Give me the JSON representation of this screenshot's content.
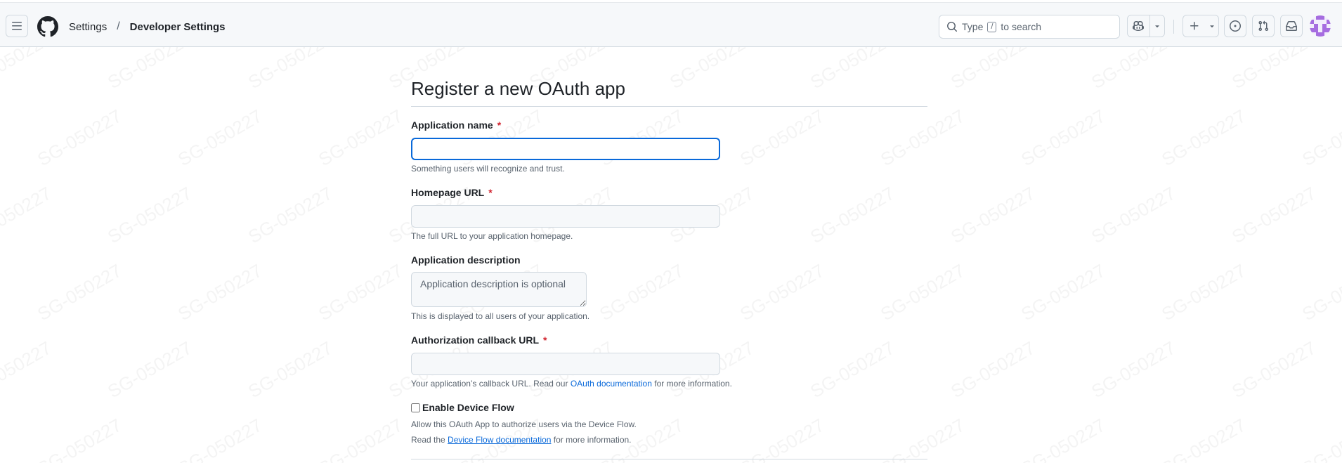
{
  "header": {
    "menu_icon": "hamburger-icon",
    "logo_icon": "github-logo-icon",
    "breadcrumb": [
      {
        "label": "Settings"
      },
      {
        "label": "Developer Settings"
      }
    ],
    "breadcrumb_separator": "/",
    "search": {
      "prefix": "Type",
      "key": "/",
      "suffix": "to search"
    },
    "actions": [
      "copilot-icon",
      "plus-icon",
      "issue-icon",
      "pull-request-icon",
      "inbox-icon"
    ]
  },
  "watermark": "SG-050227",
  "form": {
    "title": "Register a new OAuth app",
    "app_name": {
      "label": "Application name",
      "required_mark": "*",
      "value": "",
      "note": "Something users will recognize and trust."
    },
    "homepage_url": {
      "label": "Homepage URL",
      "required_mark": "*",
      "value": "",
      "note": "The full URL to your application homepage."
    },
    "description": {
      "label": "Application description",
      "placeholder": "Application description is optional",
      "note": "This is displayed to all users of your application."
    },
    "callback_url": {
      "label": "Authorization callback URL",
      "required_mark": "*",
      "value": "",
      "note_prefix": "Your application’s callback URL. Read our",
      "note_link": "OAuth documentation",
      "note_suffix": "for more information."
    },
    "device_flow": {
      "label": "Enable Device Flow",
      "checked": false,
      "note_line1": "Allow this OAuth App to authorize users via the Device Flow.",
      "note_prefix": "Read the",
      "note_link": "Device Flow documentation",
      "note_suffix": "for more information."
    }
  },
  "colors": {
    "accent": "#0969da",
    "required": "#d1242f",
    "header_bg": "#f6f8fa"
  }
}
